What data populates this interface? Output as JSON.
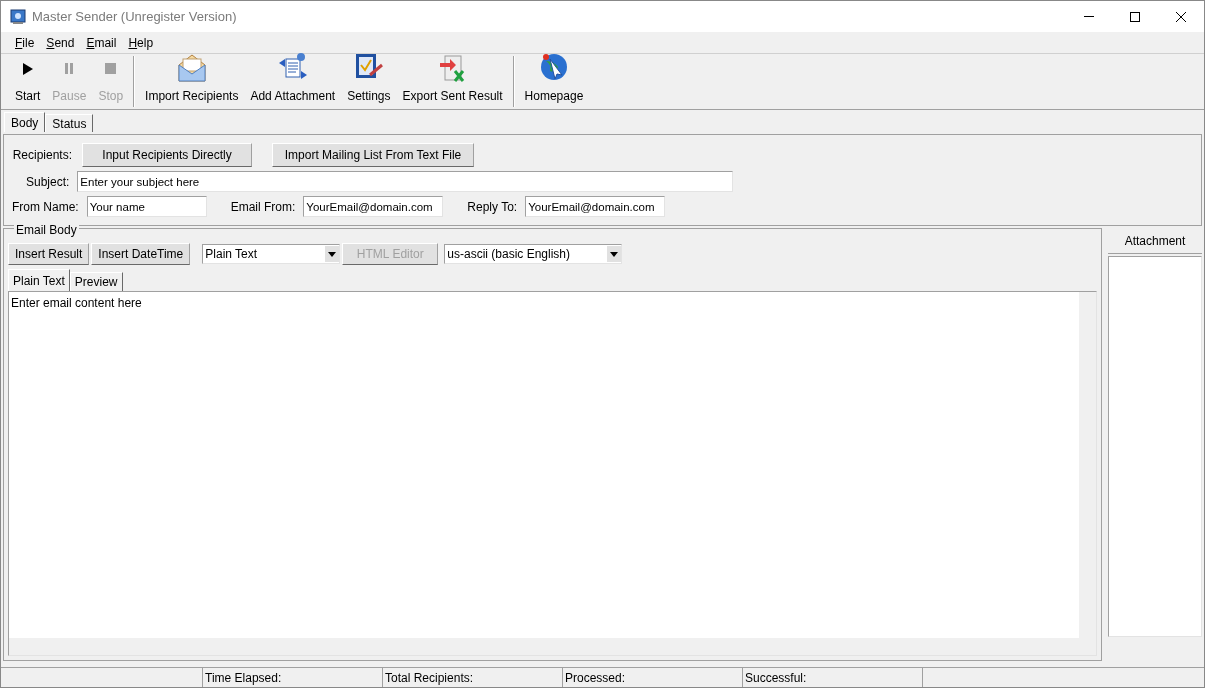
{
  "window": {
    "title": "Master Sender (Unregister Version)"
  },
  "menu": [
    "File",
    "Send",
    "Email",
    "Help"
  ],
  "toolbar": [
    {
      "label": "Start",
      "kind": "play",
      "disabled": false,
      "separator_before": false
    },
    {
      "label": "Pause",
      "kind": "pause",
      "disabled": true,
      "separator_before": false
    },
    {
      "label": "Stop",
      "kind": "stop",
      "disabled": true,
      "separator_before": false
    },
    {
      "label": "Import Recipients",
      "kind": "envelope",
      "disabled": false,
      "separator_before": true
    },
    {
      "label": "Add Attachment",
      "kind": "attach",
      "disabled": false,
      "separator_before": false
    },
    {
      "label": "Settings",
      "kind": "settings",
      "disabled": false,
      "separator_before": false
    },
    {
      "label": "Export Sent Result",
      "kind": "export",
      "disabled": false,
      "separator_before": false
    },
    {
      "label": "Homepage",
      "kind": "globe",
      "disabled": false,
      "separator_before": true
    }
  ],
  "tabs": [
    {
      "label": "Body",
      "selected": true
    },
    {
      "label": "Status",
      "selected": false
    }
  ],
  "recipients": {
    "label": "Recipients:",
    "buttons": [
      "Input Recipients Directly",
      "Import Mailing List From Text File"
    ]
  },
  "subject": {
    "label": "Subject:",
    "value": "Enter your subject here"
  },
  "from_name": {
    "label": "From Name:",
    "value": "Your name"
  },
  "email_from": {
    "label": "Email From:",
    "value": "YourEmail@domain.com"
  },
  "reply_to": {
    "label": "Reply To:",
    "value": "YourEmail@domain.com"
  },
  "email_body": {
    "title": "Email Body",
    "insert_buttons": [
      "Insert Result",
      "Insert DateTime"
    ],
    "format_select": "Plain Text",
    "html_editor": {
      "label": "HTML Editor",
      "disabled": true
    },
    "charset_select": "us-ascii (basic English)",
    "tabs": [
      {
        "label": "Plain Text",
        "selected": true
      },
      {
        "label": "Preview",
        "selected": false
      }
    ],
    "content": "Enter email content here"
  },
  "attachment": {
    "header": "Attachment"
  },
  "status_bar": [
    "Time Elapsed:",
    "Total Recipients:",
    "Processed:",
    "Successful:"
  ]
}
